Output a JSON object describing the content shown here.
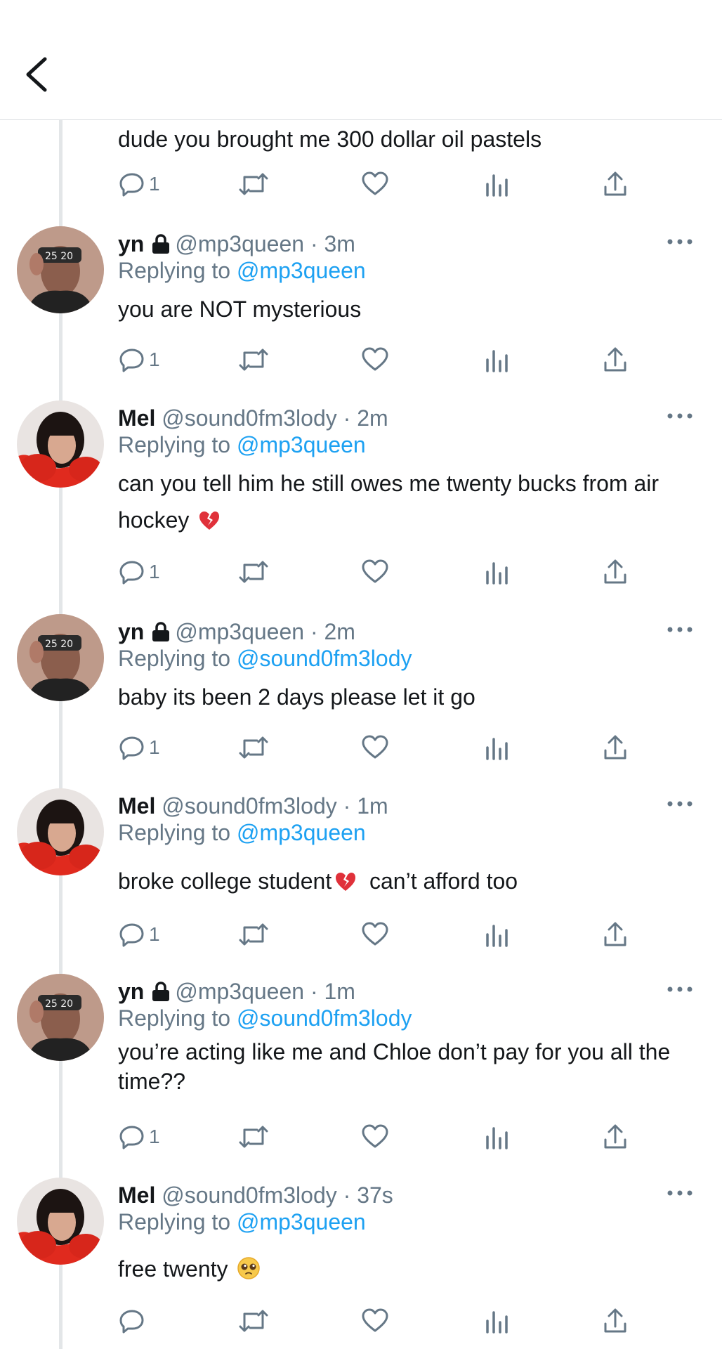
{
  "header": {
    "back_label": "<"
  },
  "tweets": [
    {
      "author": "",
      "handle": "",
      "time": "",
      "replying_prefix": "",
      "replying_to": "",
      "text": "dude you brought me 300 dollar oil pastels",
      "emoji": "",
      "text_tail": "",
      "counts": {
        "reply": "1"
      }
    },
    {
      "author": "yn",
      "handle": "@mp3queen",
      "time": "3m",
      "replying_prefix": "Replying to ",
      "replying_to": "@mp3queen",
      "text": "you are NOT mysterious",
      "emoji": "",
      "text_tail": "",
      "counts": {
        "reply": "1"
      }
    },
    {
      "author": "Mel",
      "handle": "@sound0fm3lody",
      "time": "2m",
      "replying_prefix": "Replying to ",
      "replying_to": "@mp3queen",
      "text": "can you tell him he still owes me twenty bucks from air hockey ",
      "emoji": "broken-heart",
      "text_tail": "",
      "counts": {
        "reply": "1"
      }
    },
    {
      "author": "yn",
      "handle": "@mp3queen",
      "time": "2m",
      "replying_prefix": "Replying to ",
      "replying_to": "@sound0fm3lody",
      "text": "baby its been 2 days please let it go",
      "emoji": "",
      "text_tail": "",
      "counts": {
        "reply": "1"
      }
    },
    {
      "author": "Mel",
      "handle": "@sound0fm3lody",
      "time": "1m",
      "replying_prefix": "Replying to ",
      "replying_to": "@mp3queen",
      "text": "broke college student",
      "emoji": "broken-heart",
      "text_tail": "  can’t afford too",
      "counts": {
        "reply": "1"
      }
    },
    {
      "author": "yn",
      "handle": "@mp3queen",
      "time": "1m",
      "replying_prefix": "Replying to ",
      "replying_to": "@sound0fm3lody",
      "text": "you’re acting like me and Chloe don’t pay for you all the time??",
      "emoji": "",
      "text_tail": "",
      "counts": {
        "reply": "1"
      }
    },
    {
      "author": "Mel",
      "handle": "@sound0fm3lody",
      "time": "37s",
      "replying_prefix": "Replying to ",
      "replying_to": "@mp3queen",
      "text": "free twenty ",
      "emoji": "pleading-face",
      "text_tail": "",
      "counts": {
        "reply": ""
      }
    }
  ],
  "colors": {
    "link": "#1da1f2",
    "muted": "#657786",
    "text": "#14171a",
    "divider": "#e3e6e8"
  }
}
